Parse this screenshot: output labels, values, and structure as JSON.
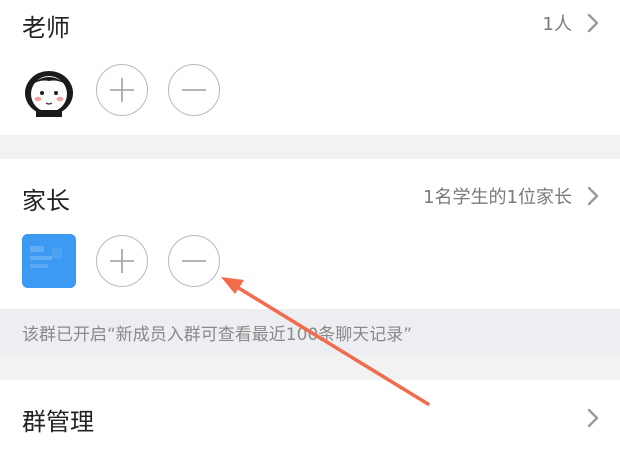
{
  "teachers": {
    "title": "老师",
    "count": "1人",
    "icons": {
      "avatar": "cartoon-girl-avatar",
      "add": "plus-icon",
      "remove": "minus-icon",
      "more": "chevron-right-icon"
    }
  },
  "parents": {
    "title": "家长",
    "summary": "1名学生的1位家长",
    "icons": {
      "avatar": "blue-avatar",
      "add": "plus-icon",
      "remove": "minus-icon",
      "more": "chevron-right-icon"
    }
  },
  "notice": {
    "text": "该群已开启“新成员入群可查看最近100条聊天记录”"
  },
  "group_management": {
    "label": "群管理"
  },
  "annotation": {
    "color": "#f26b4a"
  },
  "colors": {
    "divider": "#f2f2f2",
    "notice_bg": "#edeef2",
    "avatar_blue": "#3d9af2"
  }
}
